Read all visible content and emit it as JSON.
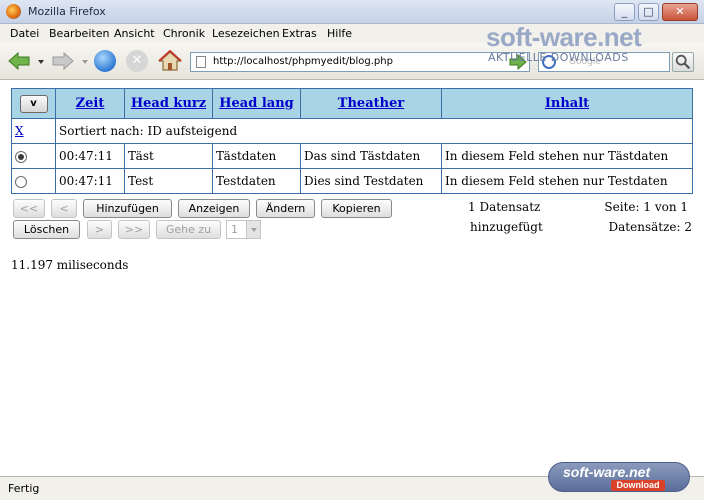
{
  "window": {
    "title": "Mozilla Firefox",
    "controls": {
      "minimize": "_",
      "maximize": "□",
      "close": "✕"
    }
  },
  "menu": [
    {
      "label": "Datei"
    },
    {
      "label": "Bearbeiten"
    },
    {
      "label": "Ansicht"
    },
    {
      "label": "Chronik"
    },
    {
      "label": "Lesezeichen"
    },
    {
      "label": "Extras"
    },
    {
      "label": "Hilfe"
    }
  ],
  "navbar": {
    "url": "http://localhost/phpmyedit/blog.php",
    "search_placeholder": "Google",
    "icons": [
      "back-arrow-icon",
      "forward-arrow-icon",
      "reload-icon",
      "stop-icon",
      "home-icon",
      "go-arrow-icon",
      "search-icon"
    ]
  },
  "watermark": {
    "main": "soft-ware.net",
    "sub": "AKTUELLE DOWNLOADS"
  },
  "table": {
    "sort_button": "v",
    "columns": [
      "Zeit",
      "Head kurz",
      "Head lang",
      "Theather",
      "Inhalt"
    ],
    "clear_sort": "X",
    "sort_info": "Sortiert nach: ID aufsteigend",
    "rows": [
      {
        "selected": true,
        "zeit": "00:47:11",
        "head_kurz": "Täst",
        "head_lang": "Tästdaten",
        "theather": "Das sind Tästdaten",
        "inhalt": "In diesem Feld stehen nur Tästdaten"
      },
      {
        "selected": false,
        "zeit": "00:47:11",
        "head_kurz": "Test",
        "head_lang": "Testdaten",
        "theather": "Dies sind Testdaten",
        "inhalt": "In diesem Feld stehen nur Testdaten"
      }
    ]
  },
  "controls": {
    "first": "<<",
    "prev": "<",
    "add": "Hinzufügen",
    "view": "Anzeigen",
    "change": "Ändern",
    "copy": "Kopieren",
    "delete": "Löschen",
    "next": ">",
    "last": ">>",
    "goto": "Gehe zu",
    "page_value": "1"
  },
  "info": {
    "message_line1": "1 Datensatz",
    "message_line2": "hinzugefügt",
    "page_info": "Seite: 1 von 1",
    "record_info": "Datensätze: 2"
  },
  "timing": "11.197 miliseconds",
  "status": {
    "text": "Fertig",
    "badge_main": "soft-ware.net",
    "badge_sub": "Download"
  }
}
